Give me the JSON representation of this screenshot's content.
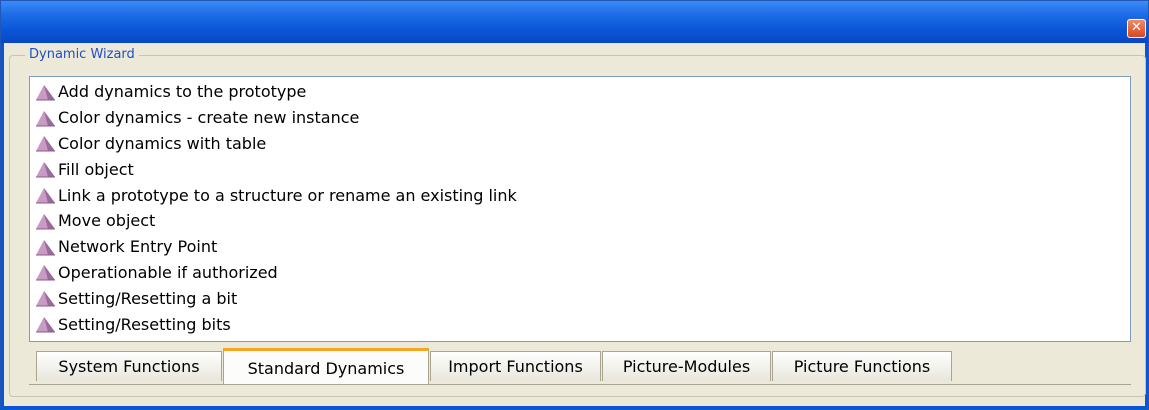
{
  "window": {
    "close_glyph": "✕"
  },
  "group": {
    "title": "Dynamic Wizard"
  },
  "list": {
    "items": [
      "Add dynamics to the prototype",
      "Color dynamics - create new instance",
      "Color dynamics with table",
      "Fill object",
      "Link a prototype to a structure or rename an existing link",
      "Move object",
      "Network Entry Point",
      "Operationable if authorized",
      "Setting/Resetting a bit",
      "Setting/Resetting bits"
    ],
    "item_icon": "wizard-wand-icon"
  },
  "tabs": [
    {
      "label": "System Functions",
      "active": false
    },
    {
      "label": "Standard Dynamics",
      "active": true
    },
    {
      "label": "Import Functions",
      "active": false
    },
    {
      "label": "Picture-Modules",
      "active": false
    },
    {
      "label": "Picture Functions",
      "active": false
    }
  ],
  "colors": {
    "title_bar": "#0a55d6",
    "group_title": "#1f4fc8",
    "active_tab_accent": "#f5a623"
  }
}
